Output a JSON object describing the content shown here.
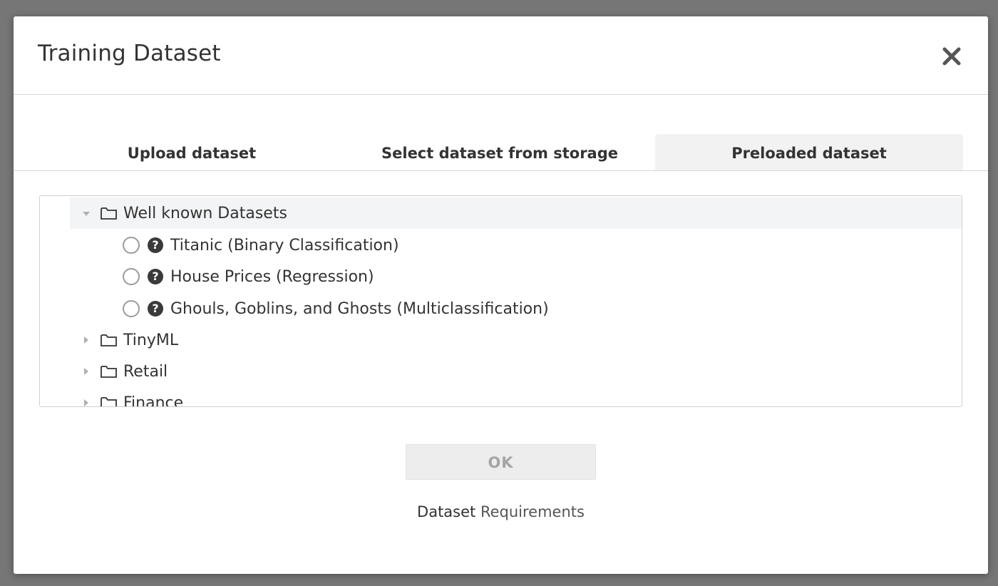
{
  "modal": {
    "title": "Training Dataset",
    "close_icon": "close-icon"
  },
  "tabs": [
    {
      "label": "Upload dataset",
      "active": false
    },
    {
      "label": "Select dataset from storage",
      "active": false
    },
    {
      "label": "Preloaded dataset",
      "active": true
    }
  ],
  "tree": {
    "folders": [
      {
        "label": "Well known Datasets",
        "expanded": true,
        "items": [
          {
            "label": "Titanic (Binary Classification)",
            "selected": false
          },
          {
            "label": "House Prices (Regression)",
            "selected": false
          },
          {
            "label": "Ghouls, Goblins, and Ghosts (Multiclassification)",
            "selected": false
          }
        ]
      },
      {
        "label": "TinyML",
        "expanded": false
      },
      {
        "label": "Retail",
        "expanded": false
      },
      {
        "label": "Finance",
        "expanded": false
      }
    ]
  },
  "footer": {
    "ok_label": "OK",
    "ok_enabled": false,
    "requirements_prefix": "Dataset",
    "requirements_link": "Requirements"
  },
  "colors": {
    "backdrop": "#767676",
    "selected_row": "#f3f4f6",
    "active_tab": "#f2f2f2"
  }
}
